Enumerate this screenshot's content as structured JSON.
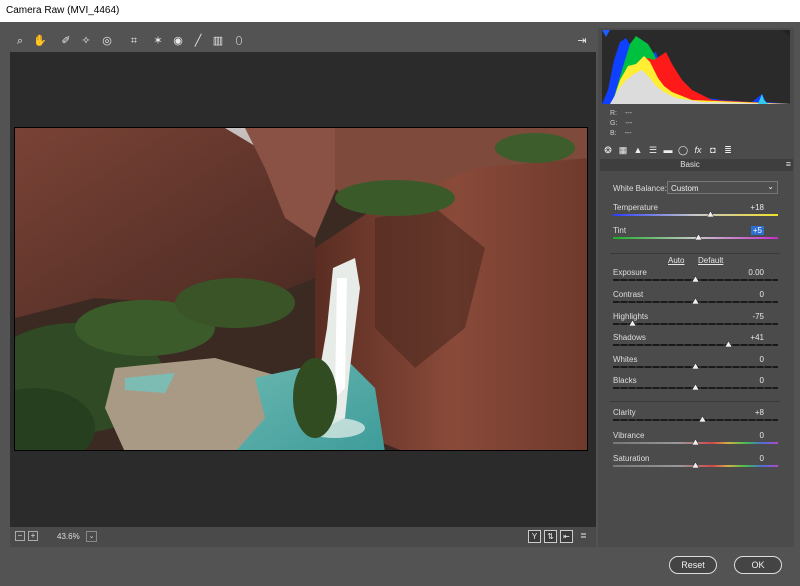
{
  "window": {
    "title": "Camera Raw (MVI_4464)"
  },
  "toolbar": {
    "tools": [
      {
        "icon": "zoom-tool-icon",
        "glyph": "⌕"
      },
      {
        "icon": "hand-tool-icon",
        "glyph": "✋"
      },
      {
        "icon": "white-balance-tool-icon",
        "glyph": "✐"
      },
      {
        "icon": "color-sampler-tool-icon",
        "glyph": "✧"
      },
      {
        "icon": "targeted-adjustment-tool-icon",
        "glyph": "◎"
      },
      {
        "icon": "crop-tool-icon",
        "glyph": "⌗"
      },
      {
        "icon": "spot-removal-tool-icon",
        "glyph": "✶"
      },
      {
        "icon": "red-eye-tool-icon",
        "glyph": "◉"
      },
      {
        "icon": "adjustment-brush-icon",
        "glyph": "╱"
      },
      {
        "icon": "graduated-filter-icon",
        "glyph": "▥"
      },
      {
        "icon": "radial-filter-icon",
        "glyph": "⬯"
      }
    ],
    "open_preferences_icon": "⇥"
  },
  "histogram": {
    "r_label": "R:",
    "g_label": "G:",
    "b_label": "B:",
    "r_value": "---",
    "g_value": "---",
    "b_value": "---"
  },
  "panel_tabs": [
    {
      "icon": "basic-tab-icon",
      "glyph": "❂"
    },
    {
      "icon": "tone-curve-tab-icon",
      "glyph": "▦"
    },
    {
      "icon": "detail-tab-icon",
      "glyph": "▲"
    },
    {
      "icon": "hsl-tab-icon",
      "glyph": "☰"
    },
    {
      "icon": "split-toning-tab-icon",
      "glyph": "▬"
    },
    {
      "icon": "lens-corrections-tab-icon",
      "glyph": "◯"
    },
    {
      "icon": "effects-tab-icon",
      "glyph": "fx"
    },
    {
      "icon": "camera-calibration-tab-icon",
      "glyph": "◘"
    },
    {
      "icon": "presets-tab-icon",
      "glyph": "≣"
    }
  ],
  "basic": {
    "title": "Basic",
    "white_balance_label": "White Balance:",
    "white_balance_value": "Custom",
    "auto_label": "Auto",
    "default_label": "Default",
    "sliders": [
      {
        "label": "Temperature",
        "value": "+18",
        "pos": 0.59,
        "track": "temp"
      },
      {
        "label": "Tint",
        "value": "+5",
        "pos": 0.52,
        "track": "tint",
        "selected": true
      },
      {
        "label": "Exposure",
        "value": "0.00",
        "pos": 0.5,
        "track": "plain"
      },
      {
        "label": "Contrast",
        "value": "0",
        "pos": 0.5,
        "track": "plain"
      },
      {
        "label": "Highlights",
        "value": "-75",
        "pos": 0.12,
        "track": "plain"
      },
      {
        "label": "Shadows",
        "value": "+41",
        "pos": 0.7,
        "track": "plain"
      },
      {
        "label": "Whites",
        "value": "0",
        "pos": 0.5,
        "track": "plain"
      },
      {
        "label": "Blacks",
        "value": "0",
        "pos": 0.5,
        "track": "plain"
      },
      {
        "label": "Clarity",
        "value": "+8",
        "pos": 0.54,
        "track": "plain"
      },
      {
        "label": "Vibrance",
        "value": "0",
        "pos": 0.5,
        "track": "vib"
      },
      {
        "label": "Saturation",
        "value": "0",
        "pos": 0.5,
        "track": "sat"
      }
    ]
  },
  "zoom": {
    "value": "43.6%",
    "minus": "−",
    "plus": "+",
    "dropdown": "⌄"
  },
  "footer_buttons": {
    "reset": "Reset",
    "ok": "OK"
  },
  "colors": {
    "accent": "#2f6fd0",
    "panel": "#4b4b4b",
    "viewer": "#2b2b2b"
  }
}
